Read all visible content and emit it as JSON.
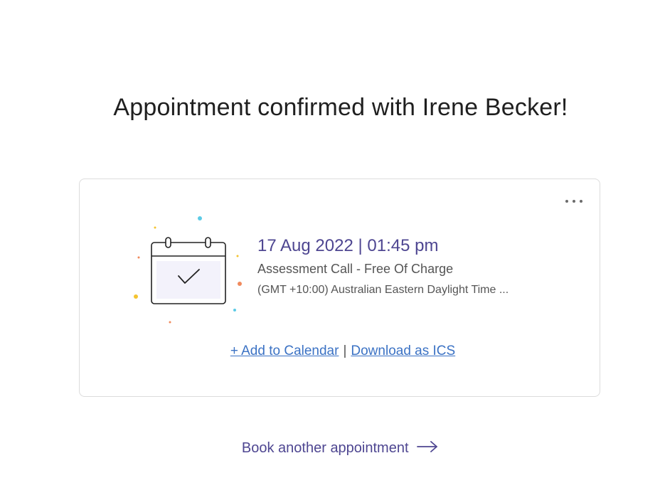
{
  "header": {
    "title": "Appointment confirmed with Irene Becker!"
  },
  "appointment": {
    "datetime": "17 Aug 2022 | 01:45 pm",
    "event_name": "Assessment Call - Free Of Charge",
    "timezone": "(GMT +10:00) Australian Eastern Daylight Time ...",
    "add_to_calendar_label": "+ Add to Calendar",
    "separator": "|",
    "download_ics_label": "Download as ICS"
  },
  "footer": {
    "book_another_label": "Book another appointment"
  },
  "icons": {
    "more": "more-horizontal-icon",
    "calendar": "calendar-check-icon",
    "arrow": "arrow-right-icon"
  },
  "colors": {
    "accent": "#4e4691",
    "link": "#3b72c4",
    "calendar_fill": "#f3f2fb"
  }
}
